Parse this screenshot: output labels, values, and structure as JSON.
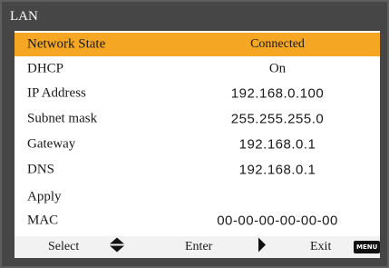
{
  "window": {
    "title": "LAN"
  },
  "rows": [
    {
      "label": "Network State",
      "value": "Connected"
    },
    {
      "label": "DHCP",
      "value": "On"
    },
    {
      "label": "IP Address",
      "value": "192.168.0.100"
    },
    {
      "label": "Subnet mask",
      "value": "255.255.255.0"
    },
    {
      "label": "Gateway",
      "value": "192.168.0.1"
    },
    {
      "label": "DNS",
      "value": "192.168.0.1"
    },
    {
      "label": "Apply",
      "value": ""
    },
    {
      "label": "MAC",
      "value": "00-00-00-00-00-00"
    }
  ],
  "selected_row": "Network State",
  "footer": {
    "select_label": "Select",
    "enter_label": "Enter",
    "exit_label": "Exit",
    "menu_key": "MENU"
  },
  "colors": {
    "highlight": "#f5a623",
    "frame": "#464646",
    "panel": "#ffffff"
  },
  "icons": {
    "select": "up-down-arrow-icon",
    "enter": "right-arrow-icon",
    "exit": "menu-key-icon"
  }
}
